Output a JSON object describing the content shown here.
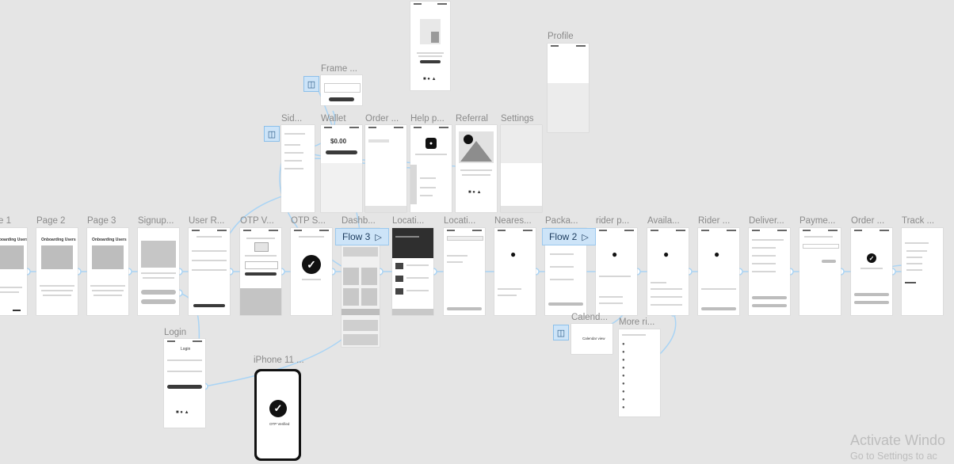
{
  "frame_labels": {
    "page1": "e 1",
    "page2": "Page 2",
    "page3": "Page 3",
    "signup": "Signup...",
    "user_reg": "User R...",
    "otp_v": "OTP V...",
    "otp_s": "OTP S...",
    "dashboard": "Dashb...",
    "location1": "Locati...",
    "location2": "Locati...",
    "nearest": "Neares...",
    "package": "Packa...",
    "rider_p": "rider p...",
    "available": "Availa...",
    "rider": "Rider ...",
    "delivery": "Deliver...",
    "payment": "Payme...",
    "order2": "Order ...",
    "track": "Track ...",
    "sidebar": "Sid...",
    "wallet": "Wallet",
    "order1": "Order ...",
    "help": "Help p...",
    "referral": "Referral",
    "settings": "Settings",
    "frame": "Frame ...",
    "profile": "Profile",
    "login": "Login",
    "iphone": "iPhone 11 ...",
    "calendar": "Calend...",
    "more_riders": "More ri..."
  },
  "flows": {
    "flow2": "Flow 2",
    "flow3": "Flow 3"
  },
  "frame_texts": {
    "onboarding": "Onboarding Users",
    "wallet_amount": "$0.00",
    "login_title": "Login",
    "otp_verified": "OTP Verified",
    "calendar_view": "Calendar view"
  },
  "watermark": {
    "line1": "Activate Windo",
    "line2": "Go to Settings to ac"
  },
  "colors": {
    "canvas": "#e5e5e5",
    "link": "#a9d4f5",
    "flow_badge": "#cde4f8"
  }
}
